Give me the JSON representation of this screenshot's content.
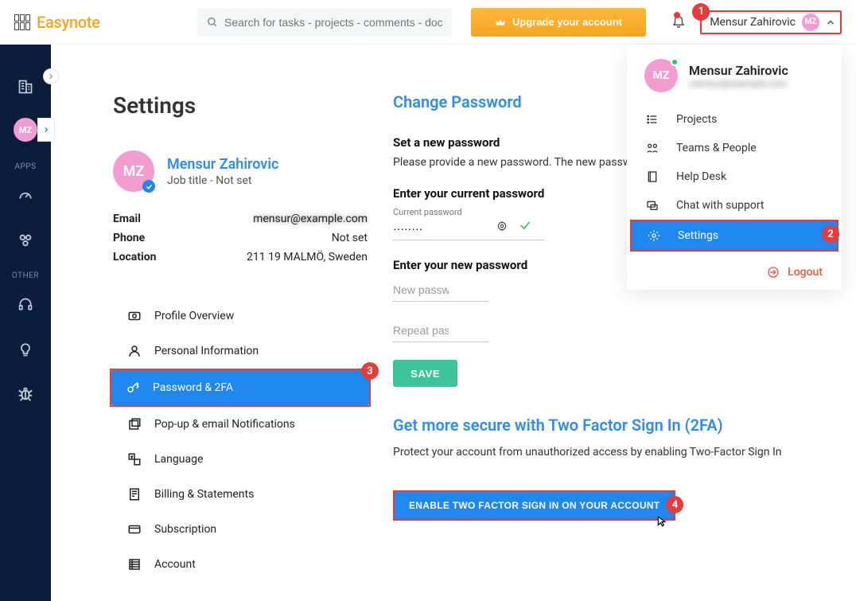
{
  "brand": {
    "name": "Easynote"
  },
  "search": {
    "placeholder": "Search for tasks - projects - comments - doc"
  },
  "upgrade_label": "Upgrade your account",
  "top_user": {
    "name": "Mensur Zahirovic",
    "initials": "MZ"
  },
  "sidebar": {
    "apps_label": "APPS",
    "other_label": "OTHER"
  },
  "page_title": "Settings",
  "profile": {
    "initials": "MZ",
    "name": "Mensur Zahirovic",
    "subtitle": "Job title - Not set",
    "info": {
      "email_k": "Email",
      "email_v": "mensur@example.com",
      "phone_k": "Phone",
      "phone_v": "Not set",
      "location_k": "Location",
      "location_v": "211 19 MALMÖ, Sweden"
    }
  },
  "nav": {
    "overview": "Profile Overview",
    "personal": "Personal Information",
    "password": "Password & 2FA",
    "popup": "Pop-up & email Notifications",
    "language": "Language",
    "billing": "Billing & Statements",
    "subscription": "Subscription",
    "account": "Account"
  },
  "password": {
    "section_title": "Change Password",
    "set_heading": "Set a new password",
    "set_sub": "Please provide a new password. The new passw",
    "current_heading": "Enter your current password",
    "current_label": "Current password",
    "current_value": "········",
    "new_heading": "Enter your new password",
    "new_placeholder": "New password",
    "repeat_placeholder": "Repeat password",
    "save": "SAVE"
  },
  "tfa": {
    "title": "Get more secure with Two Factor Sign In (2FA)",
    "sub": "Protect your account from unauthorized access by enabling Two-Factor Sign In",
    "button": "ENABLE TWO FACTOR SIGN IN ON YOUR ACCOUNT"
  },
  "dropdown": {
    "name": "Mensur Zahirovic",
    "sub": "mensur@example.com",
    "projects": "Projects",
    "teams": "Teams & People",
    "help": "Help Desk",
    "chat": "Chat with support",
    "settings": "Settings",
    "logout": "Logout"
  },
  "badges": {
    "b1": "1",
    "b2": "2",
    "b3": "3",
    "b4": "4"
  }
}
